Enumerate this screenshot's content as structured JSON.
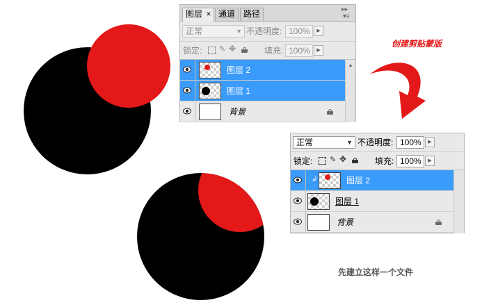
{
  "top_panel": {
    "tabs": [
      {
        "label": "图层",
        "close": "×",
        "active": true
      },
      {
        "label": "通道",
        "active": false
      },
      {
        "label": "路径",
        "active": false
      }
    ],
    "menu_icon": "panel-menu-icon",
    "blend_mode": "正常",
    "opacity_label": "不透明度:",
    "opacity_value": "100%",
    "lock_label": "锁定:",
    "fill_label": "填充:",
    "fill_value": "100%",
    "layers": [
      {
        "name": "图层 2",
        "selected": true,
        "thumb": "red-dot"
      },
      {
        "name": "图层 1",
        "selected": true,
        "thumb": "black-dot"
      },
      {
        "name": "背景",
        "selected": false,
        "thumb": "white",
        "locked": true
      }
    ]
  },
  "bottom_panel": {
    "blend_mode": "正常",
    "opacity_label": "不透明度:",
    "opacity_value": "100%",
    "lock_label": "锁定:",
    "fill_label": "填充:",
    "fill_value": "100%",
    "layers": [
      {
        "name": "图层 2",
        "selected": true,
        "thumb": "red-dot",
        "clipped": true
      },
      {
        "name": "图层 1",
        "selected": false,
        "thumb": "black-dot"
      },
      {
        "name": "背景",
        "selected": false,
        "thumb": "white",
        "locked": true
      }
    ]
  },
  "annotations": {
    "create_clip_mask": "创建剪贴蒙版",
    "caption": "先建立这样一个文件"
  },
  "colors": {
    "red": "#e31818",
    "black": "#000000",
    "selection_blue": "#3a9bfb",
    "panel_bg": "#e9e9e9"
  }
}
